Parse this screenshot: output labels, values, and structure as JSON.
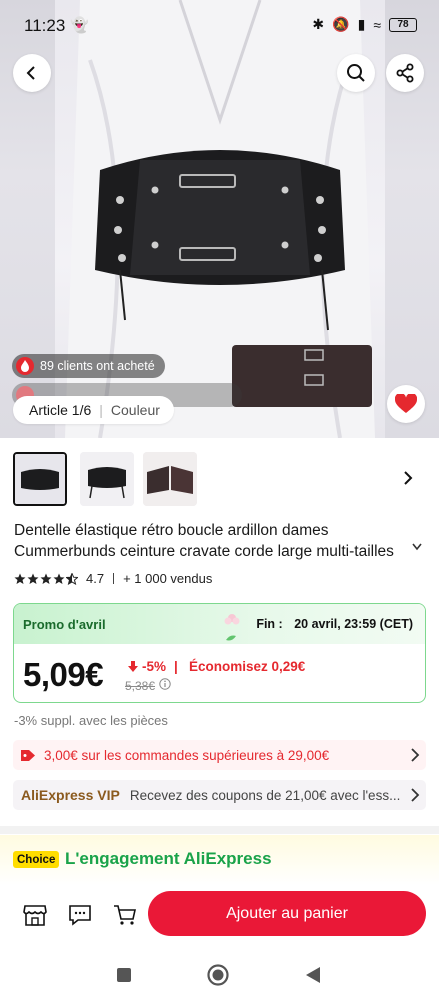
{
  "status_bar": {
    "time": "11:23",
    "battery": "78"
  },
  "hero": {
    "clients_badge": "89 clients ont acheté",
    "article_label": "Article 1/6",
    "color_label": "Couleur"
  },
  "product": {
    "title_line1": "Dentelle élastique rétro boucle ardillon dames",
    "title_line2": "Cummerbunds ceinture cravate corde large multi-tailles",
    "rating": "4.7",
    "sold": "+ 1 000 vendus"
  },
  "promo": {
    "name": "Promo d'avril",
    "end_label": "Fin :",
    "end_date": "20 avril, 23:59 (CET)",
    "price": "5,09€",
    "discount": "-5%",
    "save": "Économisez 0,29€",
    "old_price": "5,38€"
  },
  "extra_discount": "-3% suppl. avec les pièces",
  "coupon": "3,00€ sur les commandes supérieures à 29,00€",
  "vip": {
    "label": "AliExpress VIP",
    "text": "Recevez des coupons de 21,00€ avec l'ess..."
  },
  "choice": {
    "badge": "Choice",
    "text": "L'engagement AliExpress"
  },
  "bottom_bar": {
    "add_to_cart": "Ajouter au panier"
  },
  "colors": {
    "accent_red": "#ea1837",
    "promo_green": "#7dd88e",
    "choice_green": "#1aa34a",
    "choice_yellow": "#ffdd00"
  },
  "icons": [
    "back-arrow-icon",
    "search-icon",
    "share-icon",
    "heart-icon",
    "chevron-right-icon",
    "star-icon",
    "info-icon",
    "coupon-tag-icon",
    "store-icon",
    "chat-icon",
    "cart-icon"
  ]
}
